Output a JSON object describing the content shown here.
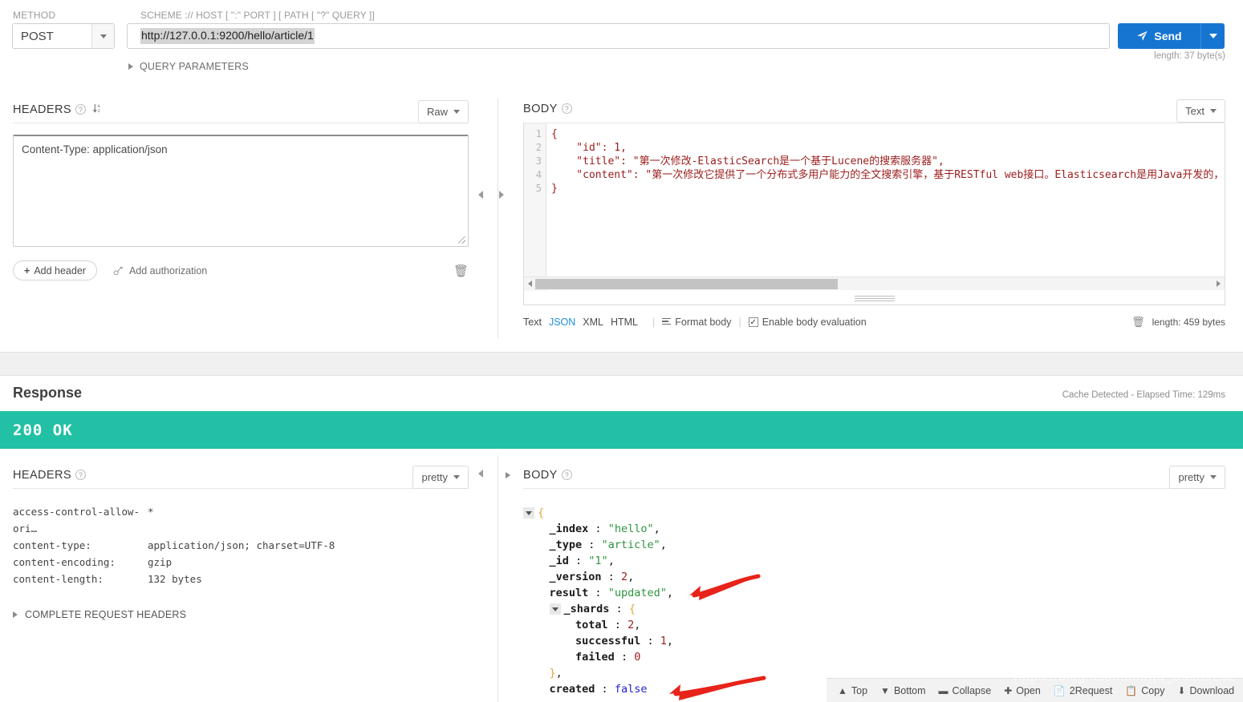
{
  "request": {
    "method_label": "METHOD",
    "method_value": "POST",
    "scheme_label": "SCHEME :// HOST [ \":\" PORT ] [ PATH [ \"?\" QUERY ]]",
    "url_value": "http://127.0.0.1:9200/hello/article/1",
    "send_label": "Send",
    "length_label": "length: 37 byte(s)",
    "query_parameters_label": "QUERY PARAMETERS",
    "headers": {
      "title": "HEADERS",
      "view_mode": "Raw",
      "textarea_value": "Content-Type: application/json",
      "add_header_label": "Add header",
      "add_authorization_label": "Add authorization"
    },
    "body": {
      "title": "BODY",
      "view_mode": "Text",
      "line_numbers": [
        "1",
        "2",
        "3",
        "4",
        "5"
      ],
      "lines": [
        "{",
        "    \"id\": 1,",
        "    \"title\": \"第一次修改-ElasticSearch是一个基于Lucene的搜索服务器\",",
        "    \"content\": \"第一次修改它提供了一个分布式多用户能力的全文搜索引擎，基于RESTful web接口。Elasticsearch是用Java开发的，",
        "}"
      ],
      "format_tabs": [
        "Text",
        "JSON",
        "XML",
        "HTML"
      ],
      "active_format_tab": "JSON",
      "format_body_label": "Format body",
      "enable_body_evaluation_label": "Enable body evaluation",
      "enable_body_evaluation_checked": true,
      "length_label": "length: 459 bytes"
    }
  },
  "response": {
    "title": "Response",
    "meta": "Cache Detected - Elapsed Time: 129ms",
    "status": "200  OK",
    "status_color": "#22c1a5",
    "headers": {
      "title": "HEADERS",
      "view_mode": "pretty",
      "rows": [
        {
          "key": "access-control-allow-ori…",
          "value": "*"
        },
        {
          "key": "content-type:",
          "value": "application/json; charset=UTF-8"
        },
        {
          "key": "content-encoding:",
          "value": "gzip"
        },
        {
          "key": "content-length:",
          "value": "132 bytes"
        }
      ],
      "complete_request_headers_label": "COMPLETE REQUEST HEADERS"
    },
    "body": {
      "title": "BODY",
      "view_mode": "pretty",
      "json": {
        "_index": "hello",
        "_type": "article",
        "_id": "1",
        "_version": 2,
        "result": "updated",
        "_shards": {
          "total": 2,
          "successful": 1,
          "failed": 0
        },
        "created": false
      },
      "tree_lines": [
        {
          "indent": 0,
          "toggle": true,
          "key": "",
          "sep": "",
          "value": "{",
          "kind": "brace",
          "trail": ""
        },
        {
          "indent": 1,
          "toggle": false,
          "key": "_index",
          "sep": " : ",
          "value": "\"hello\"",
          "kind": "s",
          "trail": ","
        },
        {
          "indent": 1,
          "toggle": false,
          "key": "_type",
          "sep": " : ",
          "value": "\"article\"",
          "kind": "s",
          "trail": ","
        },
        {
          "indent": 1,
          "toggle": false,
          "key": "_id",
          "sep": " : ",
          "value": "\"1\"",
          "kind": "s",
          "trail": ","
        },
        {
          "indent": 1,
          "toggle": false,
          "key": "_version",
          "sep": " : ",
          "value": "2",
          "kind": "n",
          "trail": ","
        },
        {
          "indent": 1,
          "toggle": false,
          "key": "result",
          "sep": " : ",
          "value": "\"updated\"",
          "kind": "s",
          "trail": ","
        },
        {
          "indent": 1,
          "toggle": true,
          "key": "_shards",
          "sep": " : ",
          "value": "{",
          "kind": "brace",
          "trail": ""
        },
        {
          "indent": 2,
          "toggle": false,
          "key": "total",
          "sep": " : ",
          "value": "2",
          "kind": "n",
          "trail": ","
        },
        {
          "indent": 2,
          "toggle": false,
          "key": "successful",
          "sep": " : ",
          "value": "1",
          "kind": "n",
          "trail": ","
        },
        {
          "indent": 2,
          "toggle": false,
          "key": "failed",
          "sep": " : ",
          "value": "0",
          "kind": "n",
          "trail": ""
        },
        {
          "indent": 1,
          "toggle": false,
          "key": "",
          "sep": "",
          "value": "}",
          "kind": "brace",
          "trail": ","
        },
        {
          "indent": 1,
          "toggle": false,
          "key": "created",
          "sep": " : ",
          "value": "false",
          "kind": "b",
          "trail": ""
        }
      ]
    }
  },
  "bottom_toolbar": {
    "items": [
      {
        "icon": "arrow-up-circle-icon",
        "label": "Top"
      },
      {
        "icon": "arrow-down-circle-icon",
        "label": "Bottom"
      },
      {
        "icon": "minus-square-icon",
        "label": "Collapse"
      },
      {
        "icon": "plus-square-icon",
        "label": "Open"
      },
      {
        "icon": "copy-page-icon",
        "label": "2Request"
      },
      {
        "icon": "copy-icon",
        "label": "Copy"
      },
      {
        "icon": "download-icon",
        "label": "Download"
      }
    ]
  },
  "watermark": "https://blog.csdn.net/qq_36639232"
}
